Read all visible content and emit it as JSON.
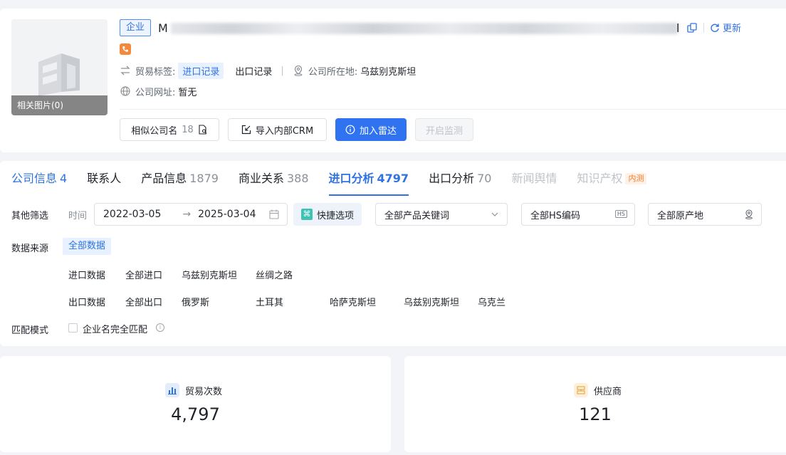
{
  "company": {
    "type_tag": "企业",
    "name_visible_prefix": "M",
    "name_visible_suffix": "l",
    "refresh_label": "更新",
    "thumb_label": "相关图片(0)",
    "trade_tags_label": "贸易标签:",
    "trade_tag_import": "进口记录",
    "trade_tag_export": "出口记录",
    "location_label": "公司所在地:",
    "location_value": "乌兹别克斯坦",
    "website_label": "公司网址:",
    "website_value": "暂无"
  },
  "actions": {
    "similar_label": "相似公司名",
    "similar_count": "18",
    "import_crm": "导入内部CRM",
    "add_radar": "加入雷达",
    "monitor": "开启监测"
  },
  "tabs": [
    {
      "label": "公司信息",
      "num": "4"
    },
    {
      "label": "联系人",
      "num": ""
    },
    {
      "label": "产品信息",
      "num": "1879"
    },
    {
      "label": "商业关系",
      "num": "388"
    },
    {
      "label": "进口分析",
      "num": "4797"
    },
    {
      "label": "出口分析",
      "num": "70"
    },
    {
      "label": "新闻舆情",
      "num": ""
    },
    {
      "label": "知识产权",
      "num": "",
      "badge": "内测"
    }
  ],
  "filters": {
    "other_label": "其他筛选",
    "time_label": "时间",
    "date_start": "2022-03-05",
    "date_sep": "→",
    "date_end": "2025-03-04",
    "quick_label": "快捷选项",
    "quick_icon": "⌘",
    "product_keyword": "全部产品关键词",
    "hs_code": "全部HS编码",
    "hs_badge": "HS",
    "origin": "全部原产地",
    "source_label": "数据来源",
    "source_all": "全部数据",
    "import_row": [
      "进口数据",
      "全部进口",
      "乌兹别克斯坦",
      "丝绸之路"
    ],
    "export_row": [
      "出口数据",
      "全部出口",
      "俄罗斯",
      "土耳其",
      "哈萨克斯坦",
      "乌兹别克斯坦",
      "乌克兰"
    ],
    "match_label": "匹配模式",
    "match_option": "企业名完全匹配",
    "info_glyph": "i"
  },
  "stats": {
    "trades_label": "贸易次数",
    "trades_value": "4,797",
    "suppliers_label": "供应商",
    "suppliers_value": "121"
  },
  "colors": {
    "primary": "#2f73f0",
    "accent_blue": "#2f73e3",
    "phone_orange": "#f5893b",
    "quick_teal": "#3ec3b3",
    "background": "#f3f4f8"
  }
}
